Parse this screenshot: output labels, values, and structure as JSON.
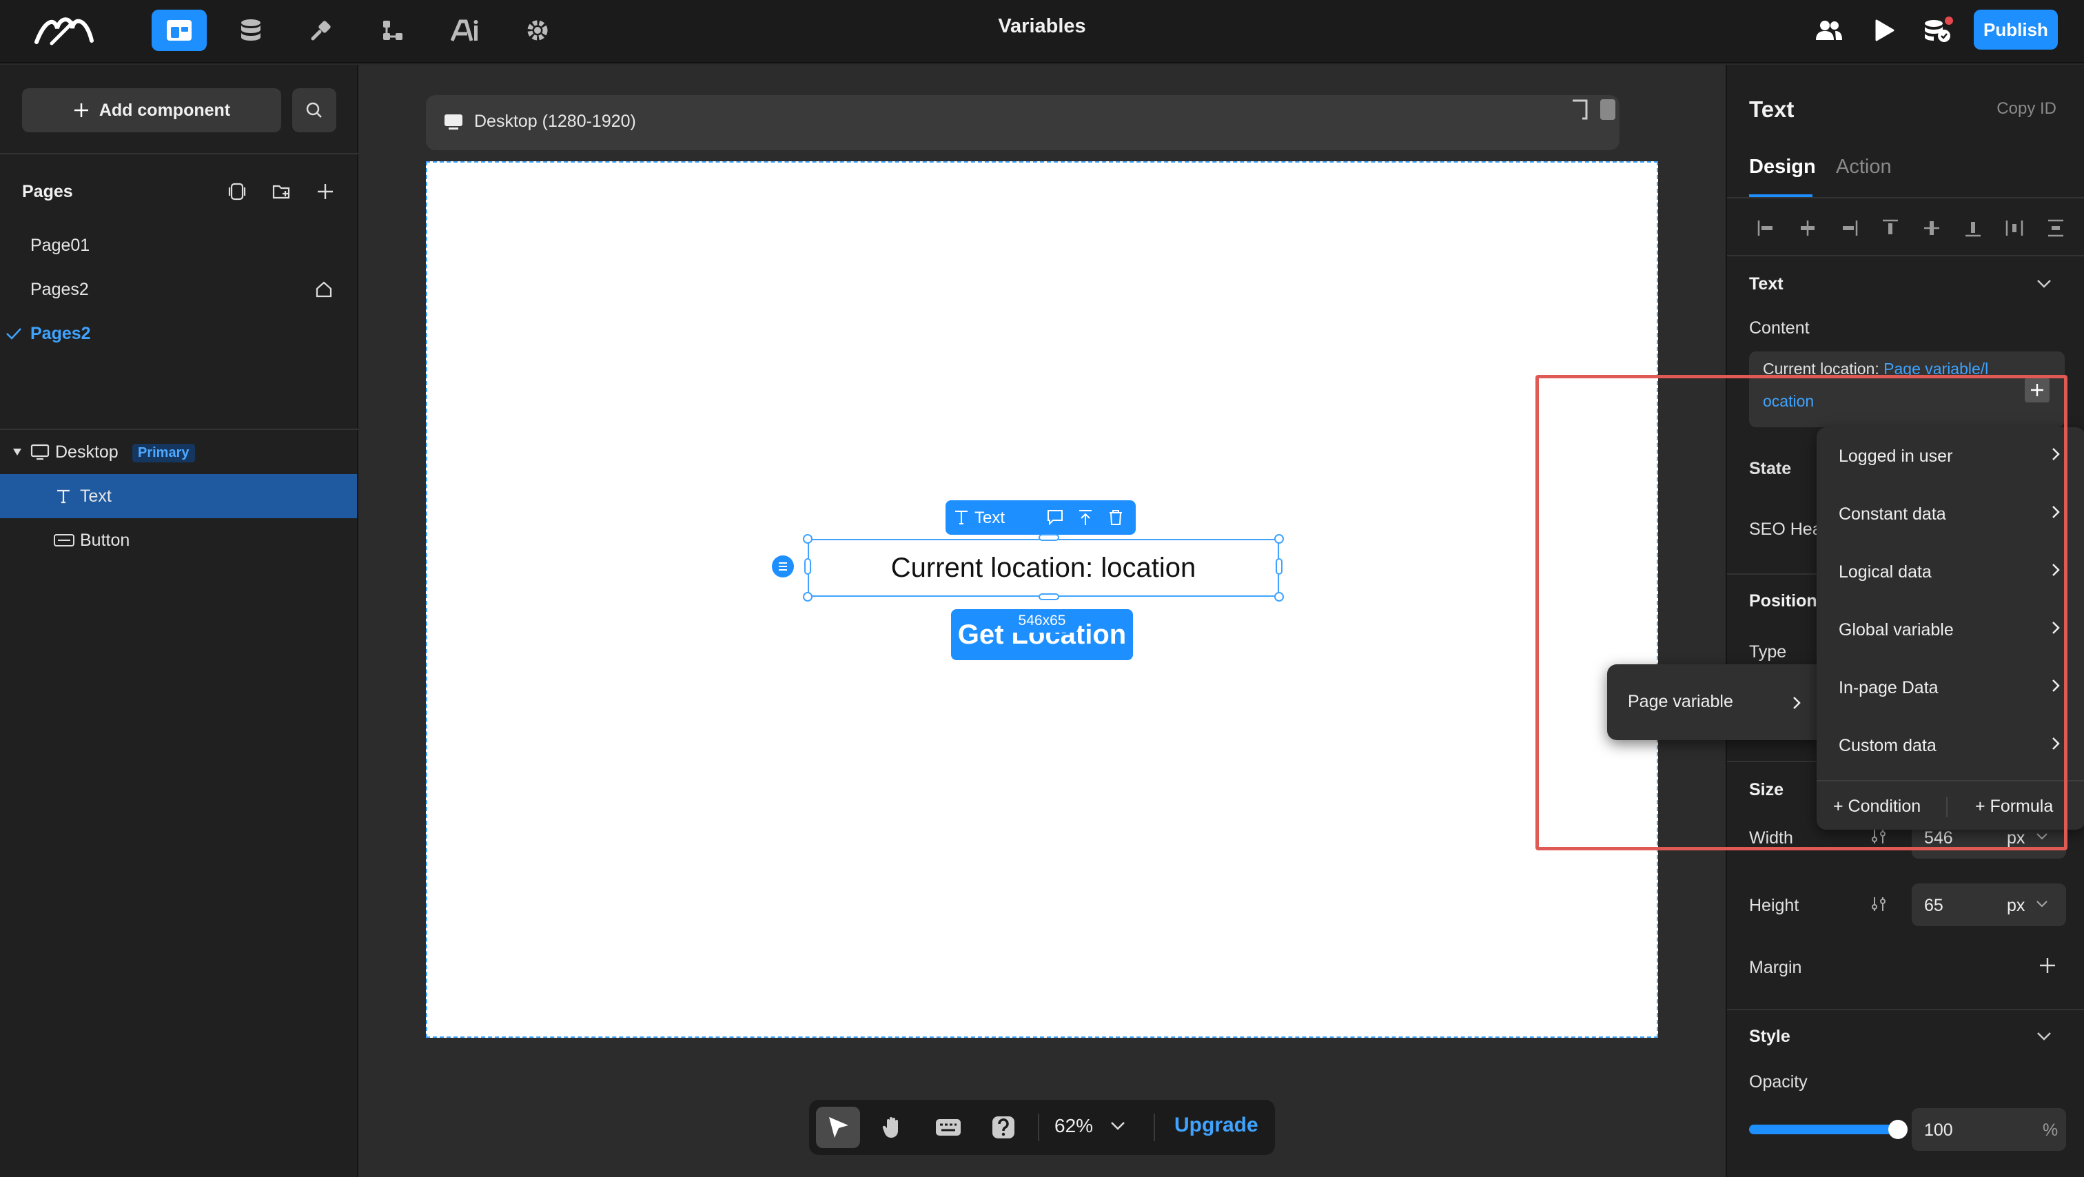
{
  "topbar": {
    "title": "Variables",
    "publish_label": "Publish",
    "icons": [
      "logo-icon",
      "pages-icon",
      "database-icon",
      "plugin-icon",
      "flow-icon",
      "ai-icon",
      "settings-icon",
      "collaborators-icon",
      "preview-icon",
      "data-status-icon"
    ]
  },
  "left": {
    "add_component_label": "Add component",
    "pages_title": "Pages",
    "pages": [
      {
        "label": "Page01"
      },
      {
        "label": "Pages2"
      },
      {
        "label": "Pages2"
      }
    ],
    "tree": {
      "desktop_label": "Desktop",
      "primary_badge": "Primary",
      "text_label": "Text",
      "button_label": "Button"
    }
  },
  "canvas": {
    "device_label": "Desktop (1280-1920)",
    "selection_toolbar_label": "Text",
    "text_content": "Current location: location",
    "size_tag": "546x65",
    "button_label": "Get Location",
    "zoom": "62%",
    "upgrade_label": "Upgrade"
  },
  "right": {
    "title": "Text",
    "copy_id": "Copy ID",
    "tabs": [
      {
        "label": "Design"
      },
      {
        "label": "Action"
      }
    ],
    "text_section": "Text",
    "content_label": "Content",
    "content_prefix": "Current location: ",
    "content_var_1": "Page variable/l",
    "content_var_2": "ocation",
    "state_label": "State",
    "seo_label": "SEO Hea",
    "position_section": "Position",
    "type_label": "Type",
    "size_section": "Size",
    "width_label": "Width",
    "width_value": "546",
    "width_unit": "px",
    "height_label": "Height",
    "height_value": "65",
    "height_unit": "px",
    "margin_label": "Margin",
    "style_section": "Style",
    "opacity_label": "Opacity",
    "opacity_value": "100",
    "opacity_unit": "%",
    "opacity_level": 1.0
  },
  "dropdown": {
    "items": [
      {
        "label": "Logged in user"
      },
      {
        "label": "Constant data"
      },
      {
        "label": "Logical data"
      },
      {
        "label": "Global variable"
      },
      {
        "label": "In-page Data"
      },
      {
        "label": "Custom data"
      }
    ],
    "condition_label": "+ Condition",
    "formula_label": "+ Formula",
    "submenu_label": "Page variable"
  },
  "colors": {
    "accent": "#1e8fff",
    "annotation": "#e05a55",
    "selected_row": "#1f5aa0"
  }
}
